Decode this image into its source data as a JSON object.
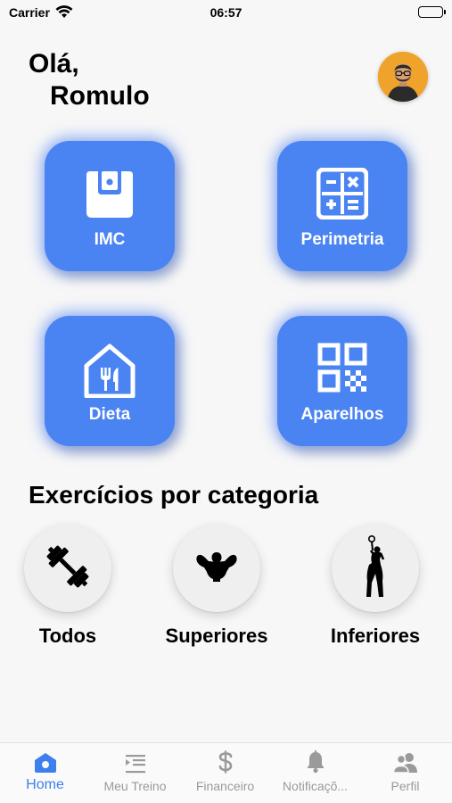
{
  "status_bar": {
    "carrier": "Carrier",
    "time": "06:57"
  },
  "greeting": {
    "hello": "Olá,",
    "name": "Romulo"
  },
  "tiles": [
    {
      "label": "IMC",
      "icon": "scale-icon"
    },
    {
      "label": "Perimetria",
      "icon": "calculator-icon"
    },
    {
      "label": "Dieta",
      "icon": "restaurant-icon"
    },
    {
      "label": "Aparelhos",
      "icon": "qr-code-icon"
    }
  ],
  "categories_title": "Exercícios por categoria",
  "categories": [
    {
      "label": "Todos",
      "icon": "barbell-icon"
    },
    {
      "label": "Superiores",
      "icon": "upper-body-icon"
    },
    {
      "label": "Inferiores",
      "icon": "lower-body-icon"
    }
  ],
  "tab_bar": [
    {
      "label": "Home",
      "icon": "home-icon",
      "active": true
    },
    {
      "label": "Meu Treino",
      "icon": "list-indent-icon",
      "active": false
    },
    {
      "label": "Financeiro",
      "icon": "dollar-icon",
      "active": false
    },
    {
      "label": "Notificaçõ...",
      "icon": "bell-icon",
      "active": false
    },
    {
      "label": "Perfil",
      "icon": "users-icon",
      "active": false
    }
  ],
  "colors": {
    "primary": "#4a83f2",
    "active_tab": "#3d7fef",
    "inactive_tab": "#9a9a9a",
    "background": "#f7f7f7"
  }
}
